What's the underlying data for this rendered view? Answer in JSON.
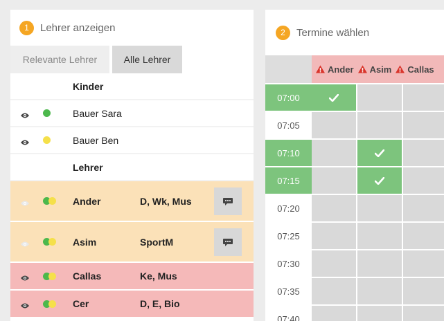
{
  "left_panel": {
    "step": "1",
    "title": "Lehrer anzeigen",
    "tabs": {
      "relevant": "Relevante Lehrer",
      "all": "Alle Lehrer"
    },
    "kinder_label": "Kinder",
    "kinder": [
      {
        "name": "Bauer Sara",
        "status_color": "#4cb84c"
      },
      {
        "name": "Bauer Ben",
        "status_color": "#f5e04a"
      }
    ],
    "lehrer_label": "Lehrer",
    "lehrer": [
      {
        "name": "Ander",
        "subjects": "D, Wk, Mus",
        "bg": "#fbe1b8"
      },
      {
        "name": "Asim",
        "subjects": "SportM",
        "bg": "#fbe1b8"
      },
      {
        "name": "Callas",
        "subjects": "Ke, Mus",
        "bg": "#f5b9b9"
      },
      {
        "name": "Cer",
        "subjects": "D, E, Bio",
        "bg": "#f5b9b9"
      }
    ]
  },
  "right_panel": {
    "step": "2",
    "title": "Termine wählen",
    "teachers": [
      "Ander",
      "Asim",
      "Callas"
    ],
    "times": [
      "07:00",
      "07:05",
      "07:10",
      "07:15",
      "07:20",
      "07:25",
      "07:30",
      "07:35",
      "07:40"
    ],
    "available_times": [
      "07:00",
      "07:10",
      "07:15"
    ],
    "booked": [
      {
        "time": "07:00",
        "teacher": "Ander"
      },
      {
        "time": "07:10",
        "teacher": "Asim"
      },
      {
        "time": "07:15",
        "teacher": "Asim"
      }
    ]
  },
  "colors": {
    "accent": "#f5a623",
    "available": "#7dc47d",
    "warning": "#d9342b"
  }
}
